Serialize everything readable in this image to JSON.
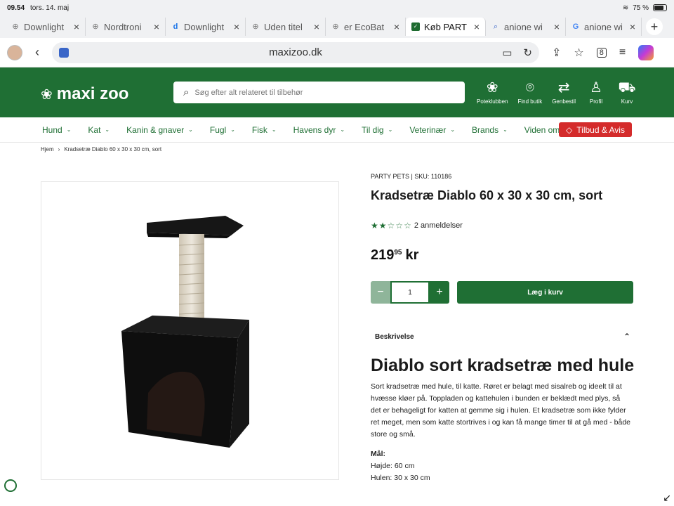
{
  "status_bar": {
    "time": "09.54",
    "date": "tors. 14. maj",
    "battery": "75 %"
  },
  "tabs": [
    {
      "label": "Downlight",
      "icon": "globe-icon",
      "active": false
    },
    {
      "label": "Nordtroni",
      "icon": "globe-icon",
      "active": false
    },
    {
      "label": "Downlight",
      "icon": "d-icon",
      "active": false
    },
    {
      "label": "Uden titel",
      "icon": "globe-icon",
      "active": false
    },
    {
      "label": "er EcoBat",
      "icon": "globe-icon",
      "active": false
    },
    {
      "label": "Køb PART",
      "icon": "maxizoo-icon",
      "active": true
    },
    {
      "label": "anione wi",
      "icon": "search-icon",
      "active": false
    },
    {
      "label": "anione wi",
      "icon": "google-icon",
      "active": false
    }
  ],
  "address": {
    "url": "maxizoo.dk"
  },
  "site": {
    "logo": "maxi zoo",
    "search_placeholder": "Søg efter alt relateret til tilbehør",
    "header_icons": [
      "Poteklubben",
      "Find butik",
      "Genbestil",
      "Profil",
      "Kurv"
    ],
    "nav": [
      "Hund",
      "Kat",
      "Kanin & gnaver",
      "Fugl",
      "Fisk",
      "Havens dyr",
      "Til dig",
      "Veterinær",
      "Brands",
      "Viden om dyr"
    ],
    "offer_button": "Tilbud & Avis",
    "accent": "#1f6f34",
    "offer_color": "#d42b2b"
  },
  "breadcrumb": {
    "home": "Hjem",
    "current": "Kradsetræ Diablo 60 x 30 x 30 cm, sort"
  },
  "product": {
    "brand_sku": "PARTY PETS | SKU: 110186",
    "title": "Kradsetræ Diablo 60 x 30 x 30 cm, sort",
    "rating": 2,
    "rating_max": 5,
    "reviews": "2 anmeldelser",
    "price_main": "219",
    "price_decimals": "95",
    "currency": "kr",
    "quantity": "1",
    "add_to_cart": "Læg i kurv"
  },
  "description": {
    "heading": "Beskrivelse",
    "title": "Diablo sort kradsetræ med hule",
    "text": "Sort kradsetræ med hule, til katte. Røret er belagt med sisalreb og ideelt til at hvæsse kløer på. Toppladen og kattehulen i bunden er beklædt med plys, så det er behageligt for katten at gemme sig i hulen. Et kradsetræ som ikke fylder ret meget, men som katte stortrives i og kan få mange timer til at gå med - både store og små.",
    "measures_heading": "Mål:",
    "height": "Højde: 60 cm",
    "cave": "Hulen: 30 x 30 cm"
  }
}
